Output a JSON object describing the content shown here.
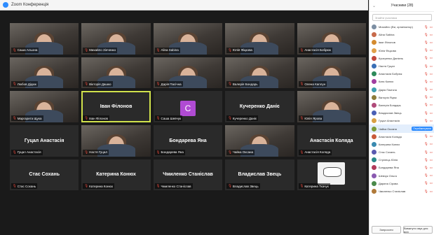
{
  "window": {
    "title": "Zoom Конференція"
  },
  "participants_panel": {
    "title": "Учасники (28)",
    "search_placeholder": "Знайти учасника",
    "rename_label": "Перейменувати",
    "invite_label": "Запросити",
    "mute_all_label": "Вимкнути звук для всіх",
    "items": [
      {
        "name": "Михайло (Ви, організатор)",
        "color": "#7d8fa3"
      },
      {
        "name": "Alina Sabina",
        "color": "#c76a4a"
      },
      {
        "name": "Іван Філонов",
        "color": "#d48b2f"
      },
      {
        "name": "Юлія Фіцкова",
        "color": "#e0a04a"
      },
      {
        "name": "Кучеренко Даніель",
        "color": "#c0473b"
      },
      {
        "name": "Настя Гуцал",
        "color": "#3a6fb5"
      },
      {
        "name": "Анастасія Бобрюк",
        "color": "#2d8a5a"
      },
      {
        "name": "Катя Конюх",
        "color": "#a03da0"
      },
      {
        "name": "Дарія Пасічна",
        "color": "#3f9fb0"
      },
      {
        "name": "Вікторія Яцюк",
        "color": "#8c7b3a"
      },
      {
        "name": "Валерія Бондарь",
        "color": "#b04b7a"
      },
      {
        "name": "Владислав Звець",
        "color": "#4a5fb5"
      },
      {
        "name": "Гуцал Анастасія",
        "color": "#d9a045"
      },
      {
        "name": "Чайка Оксана",
        "color": "#7a9b3a"
      },
      {
        "name": "Анастасія Коляда",
        "color": "#c85a3a"
      },
      {
        "name": "Катерина Конюх",
        "color": "#3a8ab0"
      },
      {
        "name": "Стас Сохань",
        "color": "#5a5ab0"
      },
      {
        "name": "Стрілець Юлія",
        "color": "#2a8a8a"
      },
      {
        "name": "Бондарева Яна",
        "color": "#b03a5a"
      },
      {
        "name": "Шевчук Ольга",
        "color": "#8a5ab0"
      },
      {
        "name": "Дарина Сірова",
        "color": "#4a8a4a"
      },
      {
        "name": "Чмиленко Станіслав",
        "color": "#b07a3a"
      }
    ]
  },
  "tiles": [
    {
      "type": "video",
      "name": "Саша Альона"
    },
    {
      "type": "video",
      "name": "Михайло Зінченко"
    },
    {
      "type": "video",
      "name": "Alina Sabina"
    },
    {
      "type": "video",
      "name": "Юлія Фіцкова"
    },
    {
      "type": "video",
      "name": "Анастасія Бобрюк"
    },
    {
      "type": "video",
      "name": "Любов Дідюк"
    },
    {
      "type": "video",
      "name": "Вікторія Дашко"
    },
    {
      "type": "video",
      "name": "Дарія Пасічна"
    },
    {
      "type": "video",
      "name": "Валерія Бондарь"
    },
    {
      "type": "video",
      "name": "Олена Каплун"
    },
    {
      "type": "video",
      "name": "Маргарита Щука"
    },
    {
      "type": "text",
      "big": "Іван Філонов",
      "name": "Іван Філонов",
      "active": true
    },
    {
      "type": "avatar",
      "letter": "C",
      "name": "Саша Шевчук"
    },
    {
      "type": "text",
      "big": "Кучеренко Даніє",
      "name": "Кучеренко Даніє"
    },
    {
      "type": "video",
      "name": "Юлія Ярова"
    },
    {
      "type": "text",
      "big": "Гуцал Анастасія",
      "name": "Гуцал Анастасія"
    },
    {
      "type": "video",
      "name": "Настя Гуцал"
    },
    {
      "type": "text",
      "big": "Бондарева Яна",
      "name": "Бондарева Яна"
    },
    {
      "type": "video",
      "name": "Чайка Оксана"
    },
    {
      "type": "text",
      "big": "Анастасія Коляда",
      "name": "Анастасія Коляда"
    },
    {
      "type": "text",
      "big": "Стас Сохань",
      "name": "Стас Сохань"
    },
    {
      "type": "text",
      "big": "Катерина Конюх",
      "name": "Катерина Конюх"
    },
    {
      "type": "text",
      "big": "Чмиленко Станіслав",
      "name": "Чмиленко Станіслав"
    },
    {
      "type": "text",
      "big": "Владислав Звець",
      "name": "Владислав Звець"
    },
    {
      "type": "cartoon",
      "name": "Катерина Ткачук"
    }
  ]
}
